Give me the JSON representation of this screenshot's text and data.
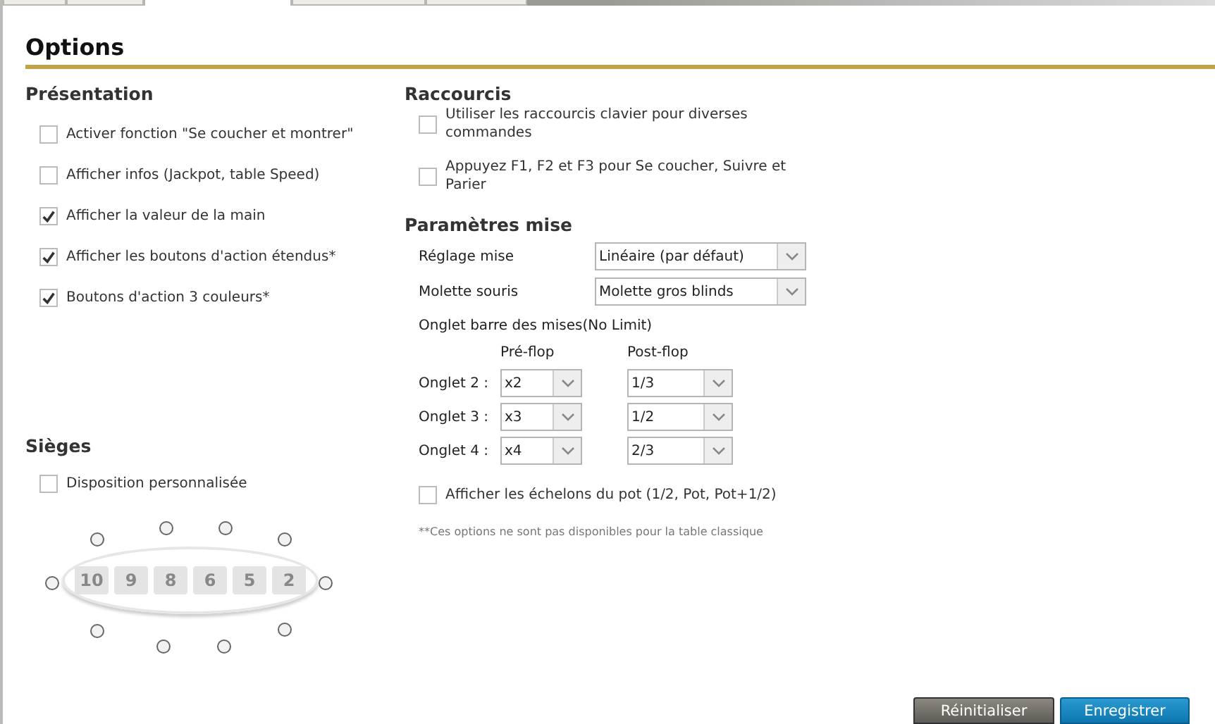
{
  "tabs": [
    {
      "selected": false
    },
    {
      "selected": false
    },
    {
      "selected": true
    },
    {
      "selected": false
    },
    {
      "selected": false
    }
  ],
  "title": "Options",
  "presentation": {
    "heading": "Présentation",
    "options": [
      {
        "label": "Activer fonction \"Se coucher et montrer\"",
        "checked": false
      },
      {
        "label": "Afficher infos (Jackpot, table Speed)",
        "checked": false
      },
      {
        "label": "Afficher la valeur de la main",
        "checked": true
      },
      {
        "label": "Afficher les boutons d'action étendus*",
        "checked": true
      },
      {
        "label": "Boutons d'action 3 couleurs*",
        "checked": true
      }
    ]
  },
  "seats": {
    "heading": "Sièges",
    "option": {
      "label": "Disposition personnalisée",
      "checked": false
    },
    "table_numbers": [
      "10",
      "9",
      "8",
      "6",
      "5",
      "2"
    ],
    "seat_buttons": [
      {
        "selected": false
      },
      {
        "selected": false
      },
      {
        "selected": false
      },
      {
        "selected": false
      },
      {
        "selected": false
      },
      {
        "selected": false
      },
      {
        "selected": false
      },
      {
        "selected": false
      },
      {
        "selected": false
      },
      {
        "selected": false
      }
    ]
  },
  "shortcuts": {
    "heading": "Raccourcis",
    "options": [
      {
        "label": "Utiliser les raccourcis clavier pour diverses commandes",
        "checked": false
      },
      {
        "label": "Appuyez F1, F2 et F3 pour Se coucher, Suivre et Parier",
        "checked": false
      }
    ]
  },
  "bet_settings": {
    "heading": "Paramètres mise",
    "fields": [
      {
        "label": "Réglage mise",
        "value": "Linéaire (par défaut)"
      },
      {
        "label": "Molette souris",
        "value": "Molette gros blinds"
      }
    ],
    "bar_heading": "Onglet barre des mises(No Limit)",
    "columns": [
      "Pré-flop",
      "Post-flop"
    ],
    "rows": [
      {
        "label": "Onglet 2 :",
        "preflop": "x2",
        "postflop": "1/3"
      },
      {
        "label": "Onglet 3 :",
        "preflop": "x3",
        "postflop": "1/2"
      },
      {
        "label": "Onglet 4 :",
        "preflop": "x4",
        "postflop": "2/3"
      }
    ],
    "pot_option": {
      "label": "Afficher les échelons du pot (1/2, Pot, Pot+1/2)",
      "checked": false
    },
    "note": "**Ces options ne sont pas disponibles pour la table classique"
  },
  "buttons": {
    "reset": "Réinitialiser",
    "save": "Enregistrer"
  }
}
